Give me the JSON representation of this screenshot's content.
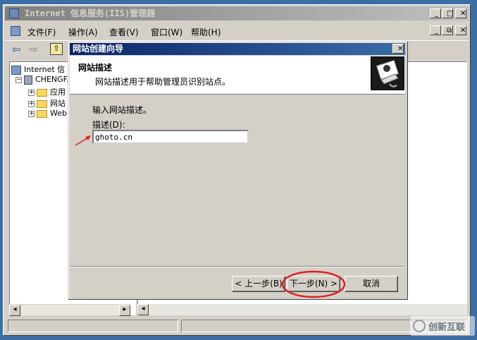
{
  "main_window": {
    "title": "Internet 信息服务(IIS)管理器",
    "caption_min": "_",
    "caption_max": "□",
    "caption_close": "✕",
    "menus": [
      "文件(F)",
      "操作(A)",
      "查看(V)",
      "窗口(W)",
      "帮助(H)"
    ],
    "child_caption_min": "_",
    "child_caption_restore": "⧉",
    "child_caption_close": "✕",
    "tree": {
      "root": "Internet 信",
      "server": "CHENGFA",
      "items": [
        "应用",
        "网站",
        "Web"
      ]
    }
  },
  "wizard": {
    "title": "网站创建向导",
    "close": "✕",
    "header_title": "网站描述",
    "header_subtitle": "网站描述用于帮助管理员识别站点。",
    "prompt": "输入网站描述。",
    "field_label": "描述(D):",
    "field_value": "ghoto.cn",
    "back_label": "< 上一步(B)",
    "next_label": "下一步(N) >",
    "cancel_label": "取消"
  },
  "watermark": "创新互联",
  "colors": {
    "desktop": "#3a6ea5",
    "active_title": "#0a246a",
    "highlight_circle": "#e02020"
  }
}
